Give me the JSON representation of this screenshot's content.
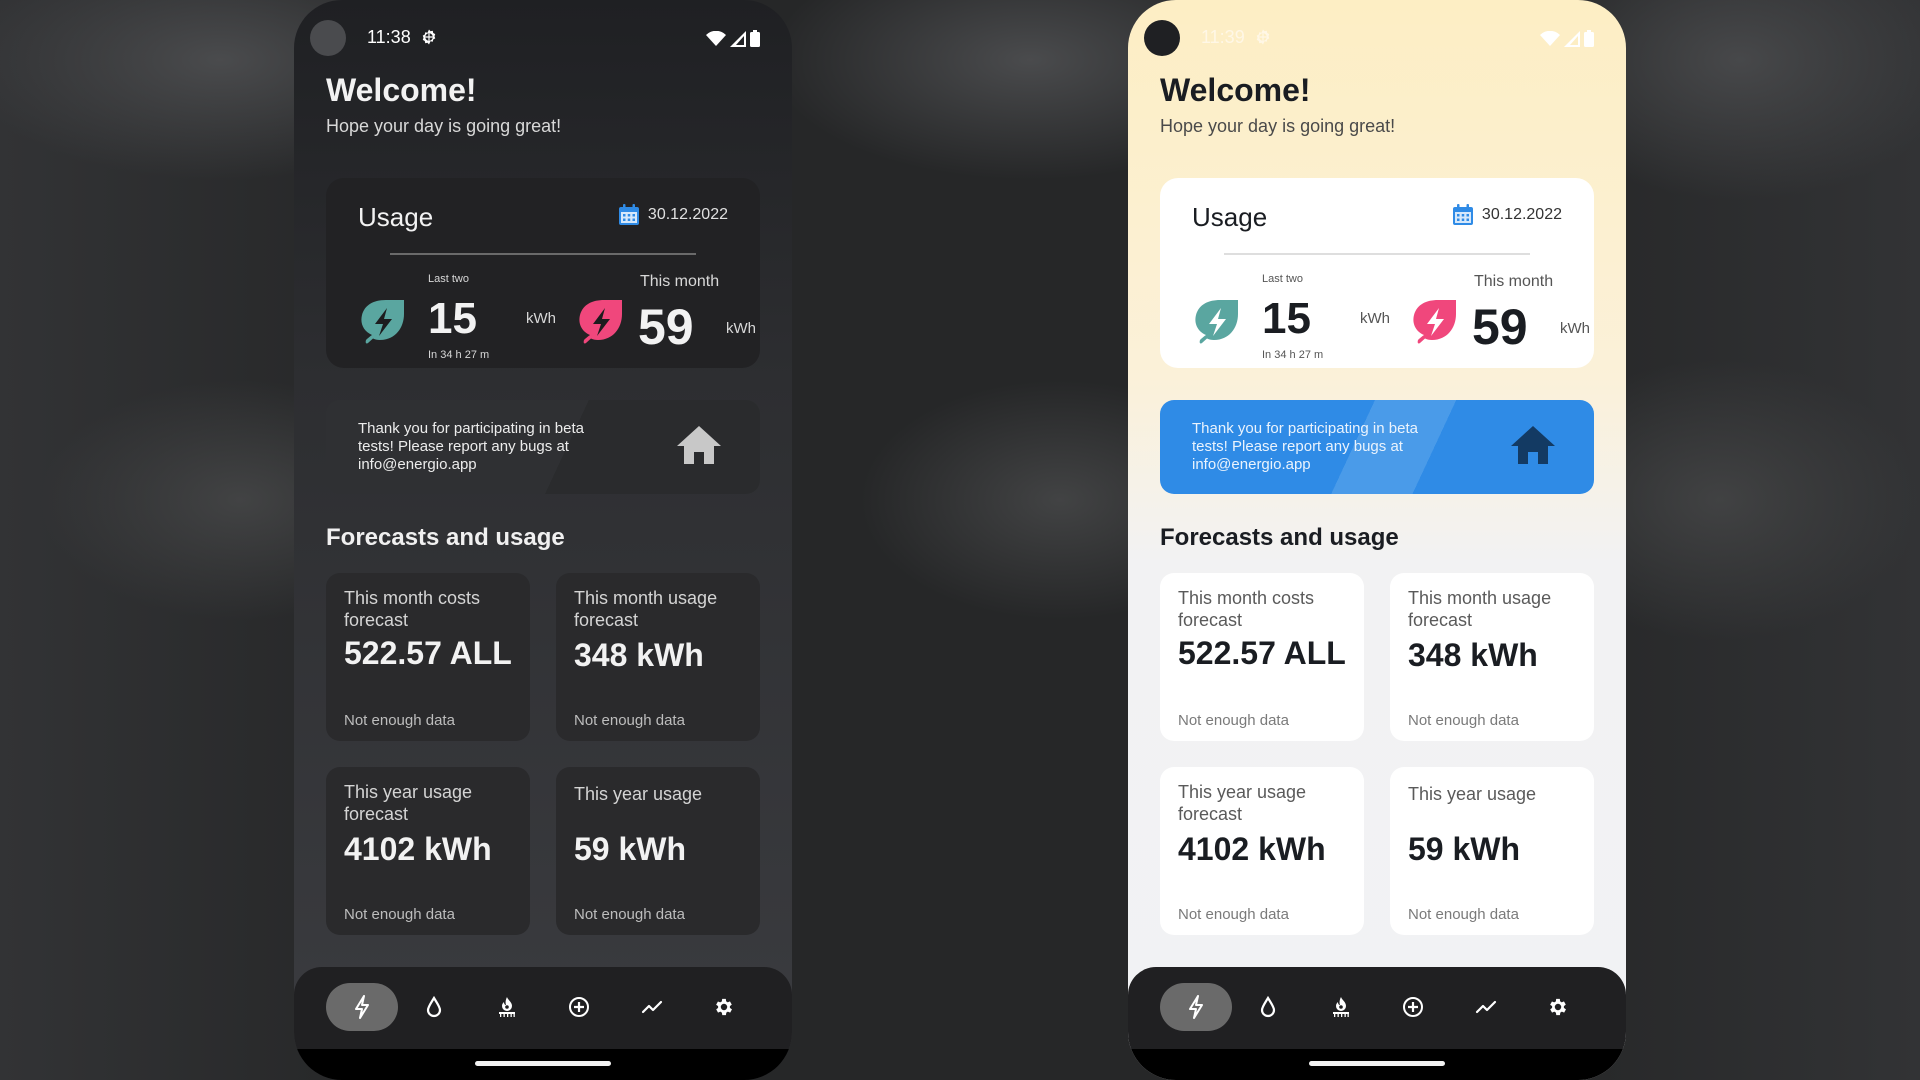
{
  "colors": {
    "accent_blue": "#2f8be6",
    "leaf_teal": "#5aa6a0",
    "leaf_pink": "#f0477c",
    "calendar_blue": "#2f8be6",
    "nav_active": "#6a6a6a"
  },
  "phones": [
    {
      "theme": "dark",
      "status": {
        "time": "11:38"
      },
      "header": {
        "title": "Welcome!",
        "subtitle": "Hope your day is going great!"
      },
      "usage": {
        "title": "Usage",
        "date": "30.12.2022",
        "last_two": {
          "label": "Last two",
          "value": "15",
          "unit": "kWh",
          "sub": "In 34 h 27 m"
        },
        "this_month": {
          "label": "This month",
          "value": "59",
          "unit": "kWh"
        }
      },
      "beta": {
        "text": "Thank you for participating in beta tests! Please report any bugs at info@energio.app"
      },
      "forecasts": {
        "title": "Forecasts and usage",
        "tiles": [
          {
            "label": "This month costs forecast",
            "value": "522.57 ALL",
            "note": "Not enough data"
          },
          {
            "label": "This month usage forecast",
            "value": "348 kWh",
            "note": "Not enough data"
          },
          {
            "label": "This year usage forecast",
            "value": "4102 kWh",
            "note": "Not enough data"
          },
          {
            "label": "This year usage",
            "value": "59 kWh",
            "note": "Not enough data"
          }
        ]
      },
      "nav": [
        {
          "icon": "electricity-icon",
          "active": true
        },
        {
          "icon": "water-icon",
          "active": false
        },
        {
          "icon": "gas-icon",
          "active": false
        },
        {
          "icon": "add-icon",
          "active": false
        },
        {
          "icon": "trend-icon",
          "active": false
        },
        {
          "icon": "settings-icon",
          "active": false
        }
      ]
    },
    {
      "theme": "light",
      "status": {
        "time": "11:39"
      },
      "header": {
        "title": "Welcome!",
        "subtitle": "Hope your day is going great!"
      },
      "usage": {
        "title": "Usage",
        "date": "30.12.2022",
        "last_two": {
          "label": "Last two",
          "value": "15",
          "unit": "kWh",
          "sub": "In 34 h 27 m"
        },
        "this_month": {
          "label": "This month",
          "value": "59",
          "unit": "kWh"
        }
      },
      "beta": {
        "text": "Thank you for participating in beta tests! Please report any bugs at info@energio.app"
      },
      "forecasts": {
        "title": "Forecasts and usage",
        "tiles": [
          {
            "label": "This month costs forecast",
            "value": "522.57 ALL",
            "note": "Not enough data"
          },
          {
            "label": "This month usage forecast",
            "value": "348 kWh",
            "note": "Not enough data"
          },
          {
            "label": "This year usage forecast",
            "value": "4102 kWh",
            "note": "Not enough data"
          },
          {
            "label": "This year usage",
            "value": "59 kWh",
            "note": "Not enough data"
          }
        ]
      },
      "nav": [
        {
          "icon": "electricity-icon",
          "active": true
        },
        {
          "icon": "water-icon",
          "active": false
        },
        {
          "icon": "gas-icon",
          "active": false
        },
        {
          "icon": "add-icon",
          "active": false
        },
        {
          "icon": "trend-icon",
          "active": false
        },
        {
          "icon": "settings-icon",
          "active": false
        }
      ]
    }
  ]
}
